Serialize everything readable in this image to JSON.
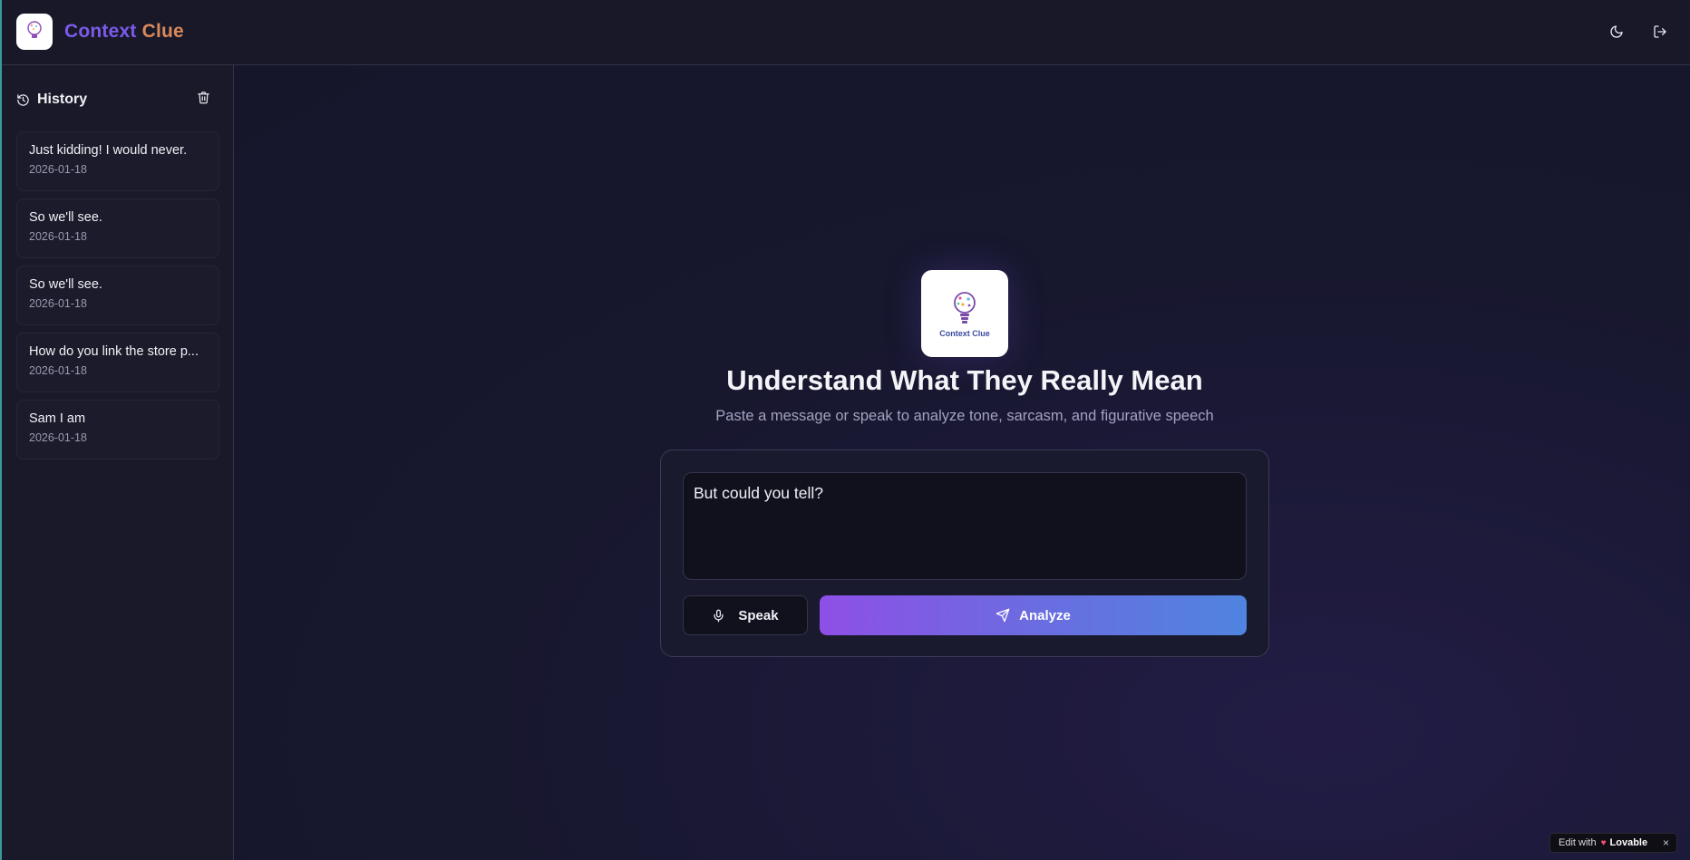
{
  "header": {
    "brand_part1": "Context",
    "brand_part2": "Clue",
    "icons": [
      "lightbulb-logo-icon",
      "moon-icon",
      "logout-icon"
    ]
  },
  "sidebar": {
    "title": "History",
    "icons": [
      "history-icon",
      "trash-icon"
    ],
    "items": [
      {
        "text": "Just kidding! I would never.",
        "date": "2026-01-18"
      },
      {
        "text": "So we'll see.",
        "date": "2026-01-18"
      },
      {
        "text": "So we'll see.",
        "date": "2026-01-18"
      },
      {
        "text": "How do you link the store p...",
        "date": "2026-01-18"
      },
      {
        "text": "Sam I am",
        "date": "2026-01-18"
      }
    ]
  },
  "main": {
    "logo_text": "Context Clue",
    "title": "Understand What They Really Mean",
    "subtitle": "Paste a message or speak to analyze tone, sarcasm, and figurative speech",
    "input_value": "But could you tell?",
    "speak_label": "Speak",
    "analyze_label": "Analyze",
    "icons": [
      "microphone-icon",
      "send-icon"
    ]
  },
  "badge": {
    "prefix": "Edit with",
    "brand": "Lovable",
    "close": "×"
  },
  "colors": {
    "brand_purple": "#7b5be8",
    "brand_orange": "#d9895a",
    "accent_gradient_start": "#8e4fe6",
    "accent_gradient_end": "#4f84e0"
  }
}
